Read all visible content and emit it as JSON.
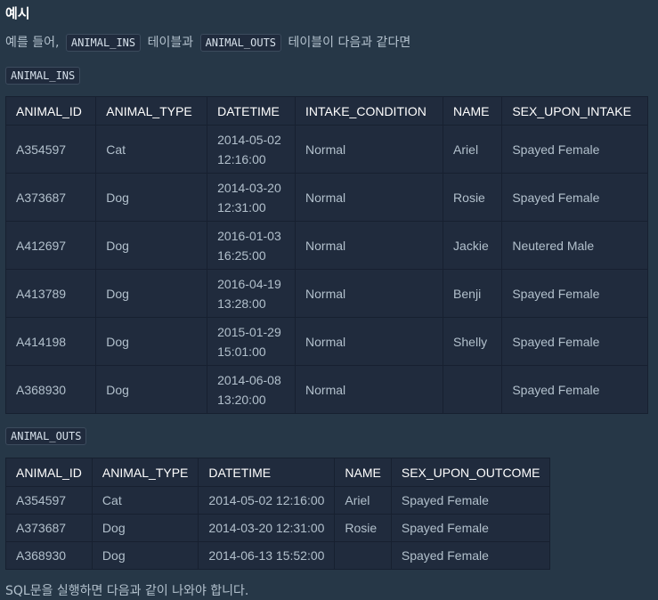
{
  "heading": "예시",
  "intro": {
    "part1": "예를 들어,",
    "code1": "ANIMAL_INS",
    "part2": "테이블과",
    "code2": "ANIMAL_OUTS",
    "part3": "테이블이 다음과 같다면"
  },
  "animal_ins": {
    "label": "ANIMAL_INS",
    "headers": [
      "ANIMAL_ID",
      "ANIMAL_TYPE",
      "DATETIME",
      "INTAKE_CONDITION",
      "NAME",
      "SEX_UPON_INTAKE"
    ],
    "rows": [
      {
        "id": "A354597",
        "type": "Cat",
        "date": "2014-05-02",
        "time": "12:16:00",
        "condition": "Normal",
        "name": "Ariel",
        "sex": "Spayed Female"
      },
      {
        "id": "A373687",
        "type": "Dog",
        "date": "2014-03-20",
        "time": "12:31:00",
        "condition": "Normal",
        "name": "Rosie",
        "sex": "Spayed Female"
      },
      {
        "id": "A412697",
        "type": "Dog",
        "date": "2016-01-03",
        "time": "16:25:00",
        "condition": "Normal",
        "name": "Jackie",
        "sex": "Neutered Male"
      },
      {
        "id": "A413789",
        "type": "Dog",
        "date": "2016-04-19",
        "time": "13:28:00",
        "condition": "Normal",
        "name": "Benji",
        "sex": "Spayed Female"
      },
      {
        "id": "A414198",
        "type": "Dog",
        "date": "2015-01-29",
        "time": "15:01:00",
        "condition": "Normal",
        "name": "Shelly",
        "sex": "Spayed Female"
      },
      {
        "id": "A368930",
        "type": "Dog",
        "date": "2014-06-08",
        "time": "13:20:00",
        "condition": "Normal",
        "name": "",
        "sex": "Spayed Female"
      }
    ]
  },
  "animal_outs": {
    "label": "ANIMAL_OUTS",
    "headers": [
      "ANIMAL_ID",
      "ANIMAL_TYPE",
      "DATETIME",
      "NAME",
      "SEX_UPON_OUTCOME"
    ],
    "rows": [
      {
        "id": "A354597",
        "type": "Cat",
        "datetime": "2014-05-02 12:16:00",
        "name": "Ariel",
        "sex": "Spayed Female"
      },
      {
        "id": "A373687",
        "type": "Dog",
        "datetime": "2014-03-20 12:31:00",
        "name": "Rosie",
        "sex": "Spayed Female"
      },
      {
        "id": "A368930",
        "type": "Dog",
        "datetime": "2014-06-13 15:52:00",
        "name": "",
        "sex": "Spayed Female"
      }
    ]
  },
  "footer": "SQL문을 실행하면 다음과 같이 나와야 합니다."
}
